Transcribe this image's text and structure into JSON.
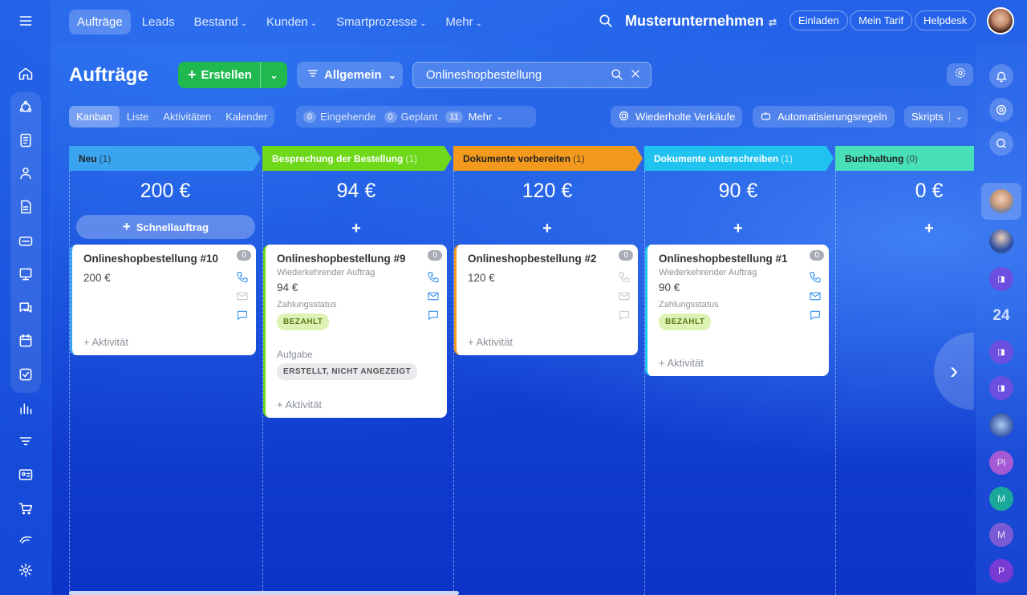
{
  "topnav": {
    "tabs": [
      {
        "label": "Aufträge"
      },
      {
        "label": "Leads"
      },
      {
        "label": "Bestand"
      },
      {
        "label": "Kunden"
      },
      {
        "label": "Smartprozesse"
      },
      {
        "label": "Mehr"
      }
    ],
    "company": "Musterunternehmen",
    "invite": "Einladen",
    "plan": "Mein Tarif",
    "helpdesk": "Helpdesk"
  },
  "toolbar": {
    "title": "Aufträge",
    "create_label": "Erstellen",
    "filter_label": "Allgemein",
    "search_value": "Onlineshopbestellung"
  },
  "views": {
    "kanban": "Kanban",
    "list": "Liste",
    "activities": "Aktivitäten",
    "calendar": "Kalender"
  },
  "counters": {
    "incoming_count": "0",
    "incoming_label": "Eingehende",
    "planned_count": "0",
    "planned_label": "Geplant",
    "more_count": "11",
    "more_label": "Mehr"
  },
  "actions": {
    "repeat_sales": "Wiederholte Verkäufe",
    "automation": "Automatisierungsregeln",
    "scripts": "Skripts"
  },
  "columns": [
    {
      "name": "Neu",
      "count": "(1)",
      "sum": "200 €",
      "color": "#3aa4f0"
    },
    {
      "name": "Besprechung der Bestellung",
      "count": "(1)",
      "sum": "94 €",
      "color": "#6ed81a"
    },
    {
      "name": "Dokumente vorbereiten",
      "count": "(1)",
      "sum": "120 €",
      "color": "#f39a1e"
    },
    {
      "name": "Dokumente unterschreiben",
      "count": "(1)",
      "sum": "90 €",
      "color": "#20c3f0"
    },
    {
      "name": "Buchhaltung",
      "count": "(0)",
      "sum": "0 €",
      "color": "#48e0b8"
    }
  ],
  "quick_add": "Schnellauftrag",
  "plus": "+",
  "cards": [
    {
      "title": "Onlineshopbestellung #10",
      "value": "200 €",
      "counter": "0",
      "activity": "+ Aktivität"
    },
    {
      "title": "Onlineshopbestellung #9",
      "subtitle": "Wiederkehrender Auftrag",
      "value": "94 €",
      "status_label": "Zahlungsstatus",
      "status": "BEZAHLT",
      "task_label": "Aufgabe",
      "task_status": "ERSTELLT, NICHT ANGEZEIGT",
      "counter": "0",
      "activity": "+ Aktivität"
    },
    {
      "title": "Onlineshopbestellung #2",
      "value": "120 €",
      "counter": "0",
      "activity": "+ Aktivität"
    },
    {
      "title": "Onlineshopbestellung #1",
      "subtitle": "Wiederkehrender Auftrag",
      "value": "90 €",
      "status_label": "Zahlungsstatus",
      "status": "BEZAHLT",
      "counter": "0",
      "activity": "+ Aktivität"
    }
  ],
  "rightbar": {
    "badge_24": "24",
    "pl": "Pl",
    "m1": "M",
    "m2": "M",
    "p": "P"
  }
}
